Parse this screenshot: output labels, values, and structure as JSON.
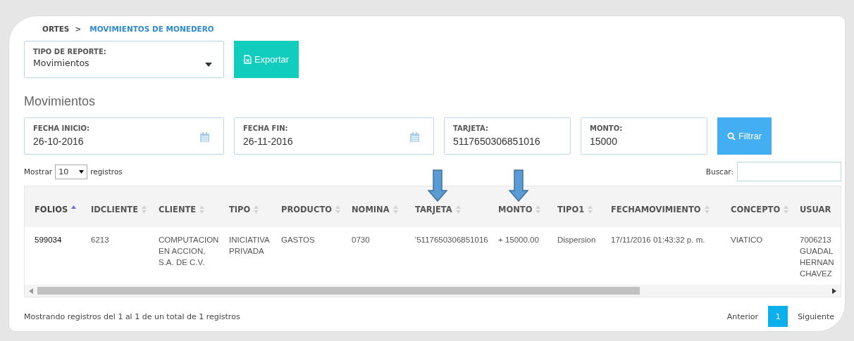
{
  "breadcrumb": {
    "parent": "ORTES",
    "separator": ">",
    "current": "MOVIMIENTOS DE MONEDERO"
  },
  "report_type": {
    "label": "TIPO DE REPORTE:",
    "value": "Movimientos"
  },
  "export_button": "Exportar",
  "section_title": "Movimientos",
  "filters": [
    {
      "label": "FECHA INICIO:",
      "value": "26-10-2016",
      "kind": "date"
    },
    {
      "label": "FECHA FIN:",
      "value": "26-11-2016",
      "kind": "date"
    },
    {
      "label": "TARJETA:",
      "value": "5117650306851016",
      "kind": "text"
    },
    {
      "label": "MONTO:",
      "value": "15000",
      "kind": "text"
    }
  ],
  "filter_button": "Filtrar",
  "page_length": {
    "prefix": "Mostrar",
    "value": "10",
    "suffix": "registros"
  },
  "search": {
    "label": "Buscar:"
  },
  "table": {
    "columns": [
      {
        "label": "FOLIOS",
        "sorted": true
      },
      {
        "label": "IDCLIENTE",
        "sorted": false
      },
      {
        "label": "CLIENTE",
        "sorted": false
      },
      {
        "label": "TIPO",
        "sorted": false
      },
      {
        "label": "PRODUCTO",
        "sorted": false
      },
      {
        "label": "NOMINA",
        "sorted": false
      },
      {
        "label": "TARJETA",
        "sorted": false
      },
      {
        "label": "MONTO",
        "sorted": false
      },
      {
        "label": "TIPO1",
        "sorted": false
      },
      {
        "label": "FECHAMOVIMIENTO",
        "sorted": false
      },
      {
        "label": "CONCEPTO",
        "sorted": false
      },
      {
        "label": "USUAR"
      }
    ],
    "rows": [
      [
        "599034",
        "6213",
        "COMPUTACION EN ACCION, S.A. DE C.V.",
        "INICIATIVA PRIVADA",
        "GASTOS",
        "0730",
        "'5117650306851016",
        "+ 15000.00",
        "Dispersion",
        "17/11/2016 01:43:32 p. m.",
        "VIATICO",
        "7006213\nGUADAL\nHERNAN\nCHAVEZ"
      ]
    ]
  },
  "info": "Mostrando registros del 1 al 1 de un total de 1 registros",
  "pagination": {
    "previous": "Anterior",
    "pages": [
      {
        "label": "1",
        "selected": true
      }
    ],
    "next": "Siguiente"
  }
}
